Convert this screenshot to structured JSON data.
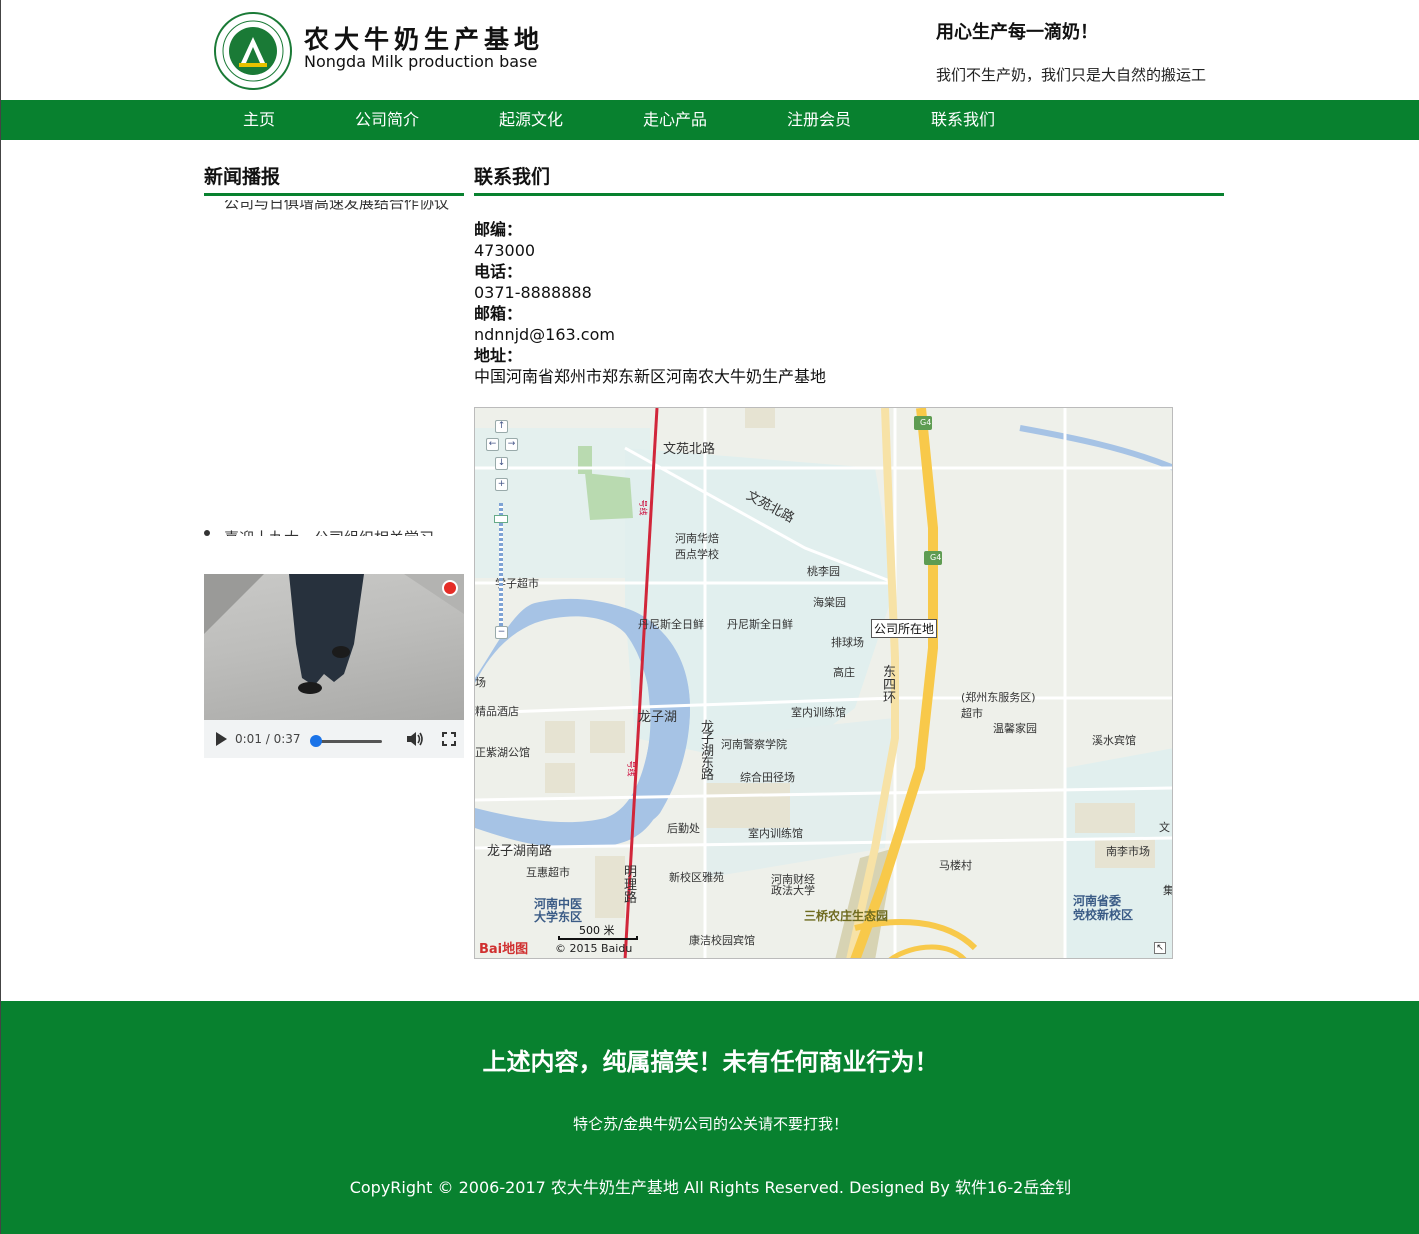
{
  "header": {
    "site_title": "农大牛奶生产基地",
    "site_subtitle": "Nongda Milk production base",
    "slogan": "用心生产每一滴奶！",
    "slogan_sub": "我们不生产奶，我们只是大自然的搬运工"
  },
  "nav": {
    "items": [
      "主页",
      "公司简介",
      "起源文化",
      "走心产品",
      "注册会员",
      "联系我们"
    ]
  },
  "sidebar": {
    "title": "新闻播报",
    "news": [
      "公司与日俱增高速发展结合作协议",
      "喜迎十九大，公司组织相关学习"
    ]
  },
  "video": {
    "time": "0:01 / 0:37",
    "progress": 0.027
  },
  "contact": {
    "title": "联系我们",
    "zip_label": "邮编：",
    "zip": "473000",
    "phone_label": "电话：",
    "phone": "0371-8888888",
    "email_label": "邮箱：",
    "email": "ndnnjd@163.com",
    "address_label": "地址：",
    "address": "中国河南省郑州市郑东新区河南农大牛奶生产基地"
  },
  "map": {
    "company_marker": "公司所在地",
    "labels": {
      "wenyuan_n": "文苑北路",
      "wenyuan_n2": "文苑北路",
      "huapei": "河南华焙\n西点学校",
      "taoliyuan": "桃李园",
      "haitangyuan": "海棠园",
      "danisi1": "丹尼斯全日鲜",
      "danisi2": "丹尼斯全日鲜",
      "paiqiu": "排球场",
      "gaozhuang": "高庄",
      "dongsihuan": "东\n四\n环",
      "fuwuqu": "(郑州东服务区)\n超市",
      "wenxinyuan": "温馨家园",
      "xishui": "溪水宾馆",
      "longzihu": "龙子湖",
      "longzihu_east": "龙\n子\n湖\n东\n路",
      "jingcha": "河南警察学院",
      "zonghe": "综合田径场",
      "shinei1": "室内训练馆",
      "shinei2": "室内训练馆",
      "houqin": "后勤处",
      "longzihu_south": "龙子湖南路",
      "huhui": "互惠超市",
      "xinxiao": "新校区雅苑",
      "caijing": "河南财经\n政法大学",
      "mingli": "明\n理\n路",
      "zhongyi": "河南中医\n大学东区",
      "kangjie": "康洁校园宾馆",
      "sanqiao": "三桥农庄生态园",
      "malou": "马楼村",
      "shengwei": "河南省委\n党校新校区",
      "nanli": "南李市场",
      "line1": "号线",
      "line2": "号线",
      "zhengzi": "正紫湖公馆",
      "jingpin": "精品酒店",
      "xuezi": "学子超市",
      "chang": "场",
      "g4a": "G4",
      "g4b": "G4",
      "wen": "文",
      "ji": "集"
    },
    "scale": "500 米",
    "baidu_logo": "Bai地图",
    "copyright": "© 2015 Baidu"
  },
  "footer": {
    "title": "上述内容，纯属搞笑！未有任何商业行为！",
    "note": "特仑苏/金典牛奶公司的公关请不要打我！",
    "copyright": "CopyRight © 2006-2017 农大牛奶生产基地 All Rights Reserved. Designed By 软件16-2岳金钊"
  },
  "colors": {
    "brand_green": "#08812f",
    "player_accent": "#1a73e8"
  }
}
